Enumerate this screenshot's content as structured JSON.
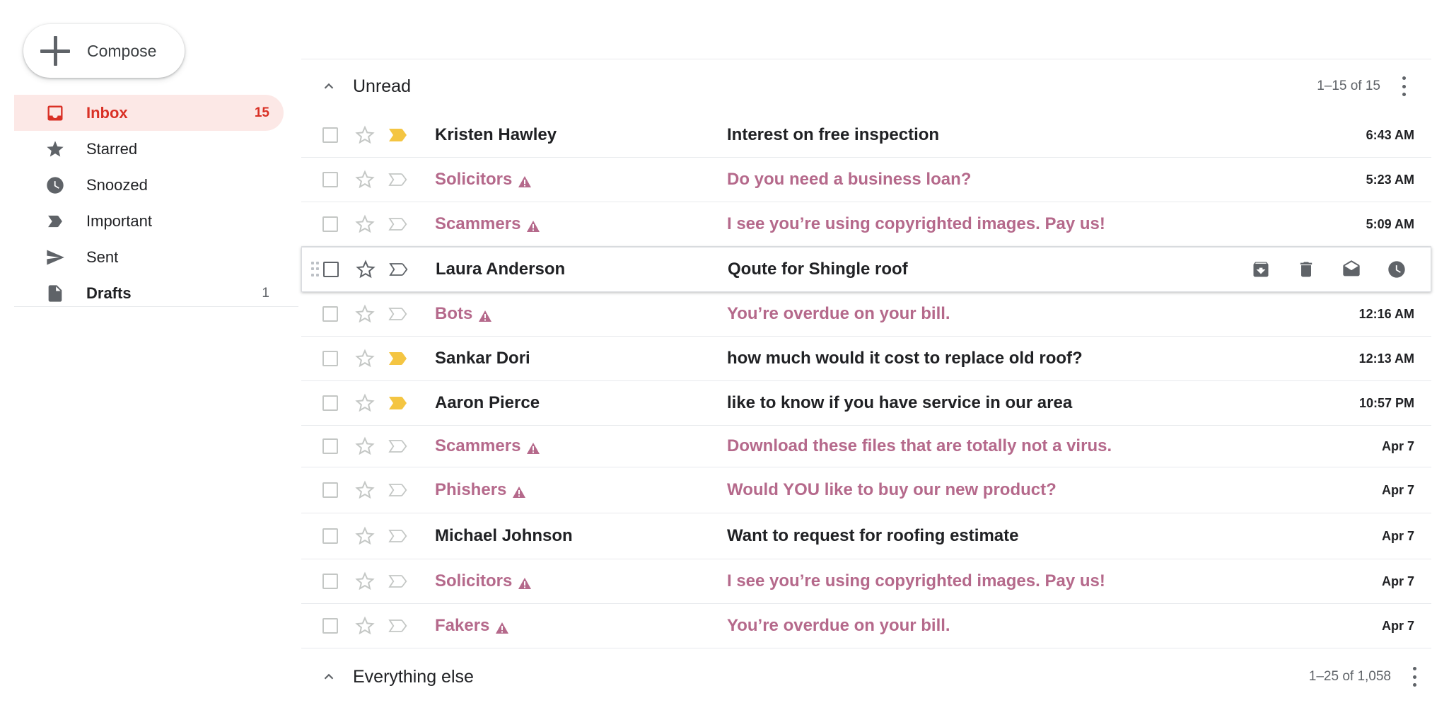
{
  "compose": {
    "label": "Compose"
  },
  "nav": {
    "items": [
      {
        "label": "Inbox",
        "count": "15",
        "icon": "inbox-icon"
      },
      {
        "label": "Starred",
        "count": "",
        "icon": "star-icon"
      },
      {
        "label": "Snoozed",
        "count": "",
        "icon": "clock-icon"
      },
      {
        "label": "Important",
        "count": "",
        "icon": "important-icon"
      },
      {
        "label": "Sent",
        "count": "",
        "icon": "send-icon"
      },
      {
        "label": "Drafts",
        "count": "1",
        "icon": "draft-icon"
      }
    ]
  },
  "sections": {
    "unread": {
      "title": "Unread",
      "count": "1–15 of 15"
    },
    "everything_else": {
      "title": "Everything else",
      "count": "1–25 of 1,058"
    }
  },
  "emails": [
    {
      "sender": "Kristen Hawley",
      "subject": "Interest on free inspection",
      "time": "6:43 AM",
      "important": true,
      "spam": false
    },
    {
      "sender": "Solicitors",
      "subject": "Do you need a business loan?",
      "time": "5:23 AM",
      "important": false,
      "spam": true
    },
    {
      "sender": "Scammers",
      "subject": "I see you’re using copyrighted images. Pay us!",
      "time": "5:09 AM",
      "important": false,
      "spam": true
    },
    {
      "sender": "Laura Anderson",
      "subject": "Qoute for Shingle roof",
      "time": "",
      "important": false,
      "spam": false,
      "hover": true
    },
    {
      "sender": "Bots",
      "subject": "You’re overdue on your bill.",
      "time": "12:16 AM",
      "important": false,
      "spam": true
    },
    {
      "sender": "Sankar Dori",
      "subject": "how much would it cost to replace old roof?",
      "time": "12:13 AM",
      "important": true,
      "spam": false
    },
    {
      "sender": "Aaron Pierce",
      "subject": "like to know if you have service in our area",
      "time": "10:57 PM",
      "important": true,
      "spam": false
    },
    {
      "sender": "Scammers",
      "subject": "Download these files that are totally not a virus.",
      "time": "Apr 7",
      "important": false,
      "spam": true
    },
    {
      "sender": "Phishers",
      "subject": "Would YOU like to buy our new product?",
      "time": "Apr 7",
      "important": false,
      "spam": true
    },
    {
      "sender": "Michael Johnson",
      "subject": "Want to request for roofing estimate",
      "time": "Apr 7",
      "important": false,
      "spam": false
    },
    {
      "sender": "Solicitors",
      "subject": "I see you’re using copyrighted images. Pay us!",
      "time": "Apr 7",
      "important": false,
      "spam": true
    },
    {
      "sender": "Fakers",
      "subject": "You’re overdue on your bill.",
      "time": "Apr 7",
      "important": false,
      "spam": true
    }
  ],
  "row_actions": [
    "archive-icon",
    "trash-icon",
    "mark-read-icon",
    "snooze-icon"
  ],
  "colors": {
    "accent": "#d93025",
    "active_bg": "#fce8e6",
    "spam_text": "#b5698b",
    "important_marker": "#f4c542",
    "icon_gray": "#5f6368"
  }
}
